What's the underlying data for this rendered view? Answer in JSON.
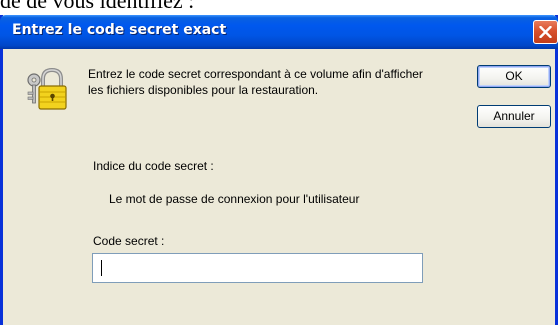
{
  "page": {
    "top_text": "de de vous identifiez :"
  },
  "dialog": {
    "title": "Entrez le code secret exact",
    "message": "Entrez le code secret correspondant à ce volume afin d'afficher les fichiers disponibles pour la restauration.",
    "buttons": {
      "ok_label": "OK",
      "cancel_label": "Annuler"
    },
    "hint": {
      "label": "Indice du code secret :",
      "text": "Le mot de passe de connexion pour l'utilisateur"
    },
    "password": {
      "label": "Code secret :",
      "value": ""
    }
  },
  "icons": {
    "close": "close-icon",
    "lock": "lock-keys-icon"
  },
  "colors": {
    "titlebar": "#0058ee",
    "dialog_bg": "#ece9d8",
    "close_button": "#d8502c",
    "frame": "#0831d9"
  }
}
